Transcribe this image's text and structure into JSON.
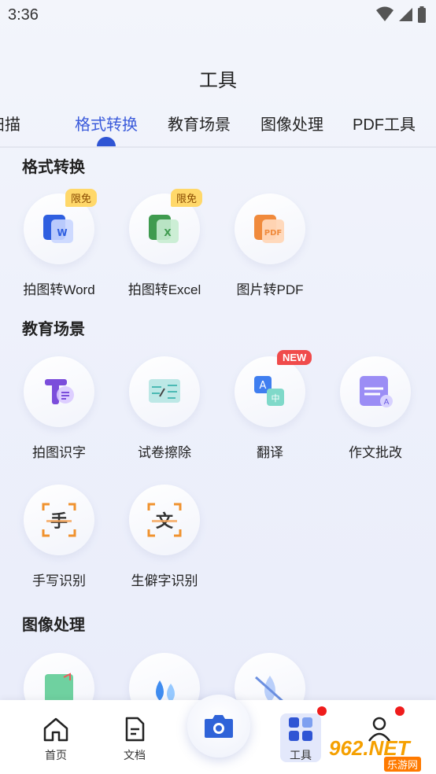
{
  "status": {
    "time": "3:36"
  },
  "title": "工具",
  "tabs": [
    "扫描",
    "格式转换",
    "教育场景",
    "图像处理",
    "PDF工具"
  ],
  "active_tab": "格式转换",
  "sections": {
    "format": {
      "title": "格式转换",
      "items": [
        {
          "label": "拍图转Word",
          "badge": "限免",
          "icon": "word-icon"
        },
        {
          "label": "拍图转Excel",
          "badge": "限免",
          "icon": "excel-icon"
        },
        {
          "label": "图片转PDF",
          "icon": "pdf-icon"
        }
      ]
    },
    "education": {
      "title": "教育场景",
      "items": [
        {
          "label": "拍图识字",
          "icon": "text-recognition-icon"
        },
        {
          "label": "试卷擦除",
          "icon": "paper-erase-icon"
        },
        {
          "label": "翻译",
          "badge": "NEW",
          "icon": "translate-icon"
        },
        {
          "label": "作文批改",
          "icon": "essay-correct-icon"
        },
        {
          "label": "手写识别",
          "icon": "handwriting-icon"
        },
        {
          "label": "生僻字识别",
          "icon": "rare-char-icon"
        }
      ]
    },
    "image": {
      "title": "图像处理",
      "items": [
        {
          "icon": "image-crop-icon"
        },
        {
          "icon": "water-drop-icon"
        },
        {
          "icon": "watermark-remove-icon"
        }
      ]
    }
  },
  "nav": {
    "home": "首页",
    "docs": "文档",
    "tools": "工具",
    "profile": ""
  },
  "watermark": {
    "brand": "962.NET",
    "sub": "乐游网"
  },
  "colors": {
    "accent": "#3b5bdb",
    "badge": "#ffd86a",
    "new_badge": "#f04b4b"
  }
}
